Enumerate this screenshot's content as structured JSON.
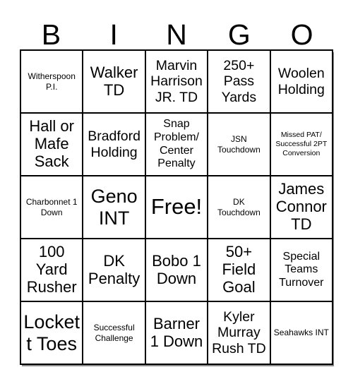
{
  "card": {
    "title": "BINGO",
    "headers": [
      "B",
      "I",
      "N",
      "G",
      "O"
    ],
    "rows": [
      [
        {
          "text": "Witherspoon P.I.",
          "size": "s-sm"
        },
        {
          "text": "Walker TD",
          "size": "s-xl"
        },
        {
          "text": "Marvin Harrison JR. TD",
          "size": "s-lg"
        },
        {
          "text": "250+ Pass Yards",
          "size": "s-lg"
        },
        {
          "text": "Woolen Holding",
          "size": "s-lg"
        }
      ],
      [
        {
          "text": "Hall or Mafe Sack",
          "size": "s-xl"
        },
        {
          "text": "Bradford Holding",
          "size": "s-lg"
        },
        {
          "text": "Snap Problem/ Center Penalty",
          "size": "s-md"
        },
        {
          "text": "JSN Touchdown",
          "size": "s-sm"
        },
        {
          "text": "Missed PAT/ Successful 2PT Conversion",
          "size": "s-xs"
        }
      ],
      [
        {
          "text": "Charbonnet 1 Down",
          "size": "s-sm"
        },
        {
          "text": "Geno INT",
          "size": "s-xxl"
        },
        {
          "text": "Free!",
          "size": "s-free"
        },
        {
          "text": "DK Touchdown",
          "size": "s-sm"
        },
        {
          "text": "James Connor TD",
          "size": "s-xl"
        }
      ],
      [
        {
          "text": "100 Yard Rusher",
          "size": "s-xl"
        },
        {
          "text": "DK Penalty",
          "size": "s-xl"
        },
        {
          "text": "Bobo 1 Down",
          "size": "s-xl"
        },
        {
          "text": "50+ Field Goal",
          "size": "s-xl"
        },
        {
          "text": "Special Teams Turnover",
          "size": "s-md"
        }
      ],
      [
        {
          "text": "Lockett Toes",
          "size": "s-xxl"
        },
        {
          "text": "Successful Challenge",
          "size": "s-sm"
        },
        {
          "text": "Barner 1 Down",
          "size": "s-xl"
        },
        {
          "text": "Kyler Murray Rush TD",
          "size": "s-lg"
        },
        {
          "text": "Seahawks INT",
          "size": "s-sm"
        }
      ]
    ],
    "free_space": {
      "row": 2,
      "col": 2,
      "label": "Free!"
    },
    "colors": {
      "background": "#ffffff",
      "text": "#000000",
      "border": "#000000",
      "shadow": "#787878"
    }
  }
}
